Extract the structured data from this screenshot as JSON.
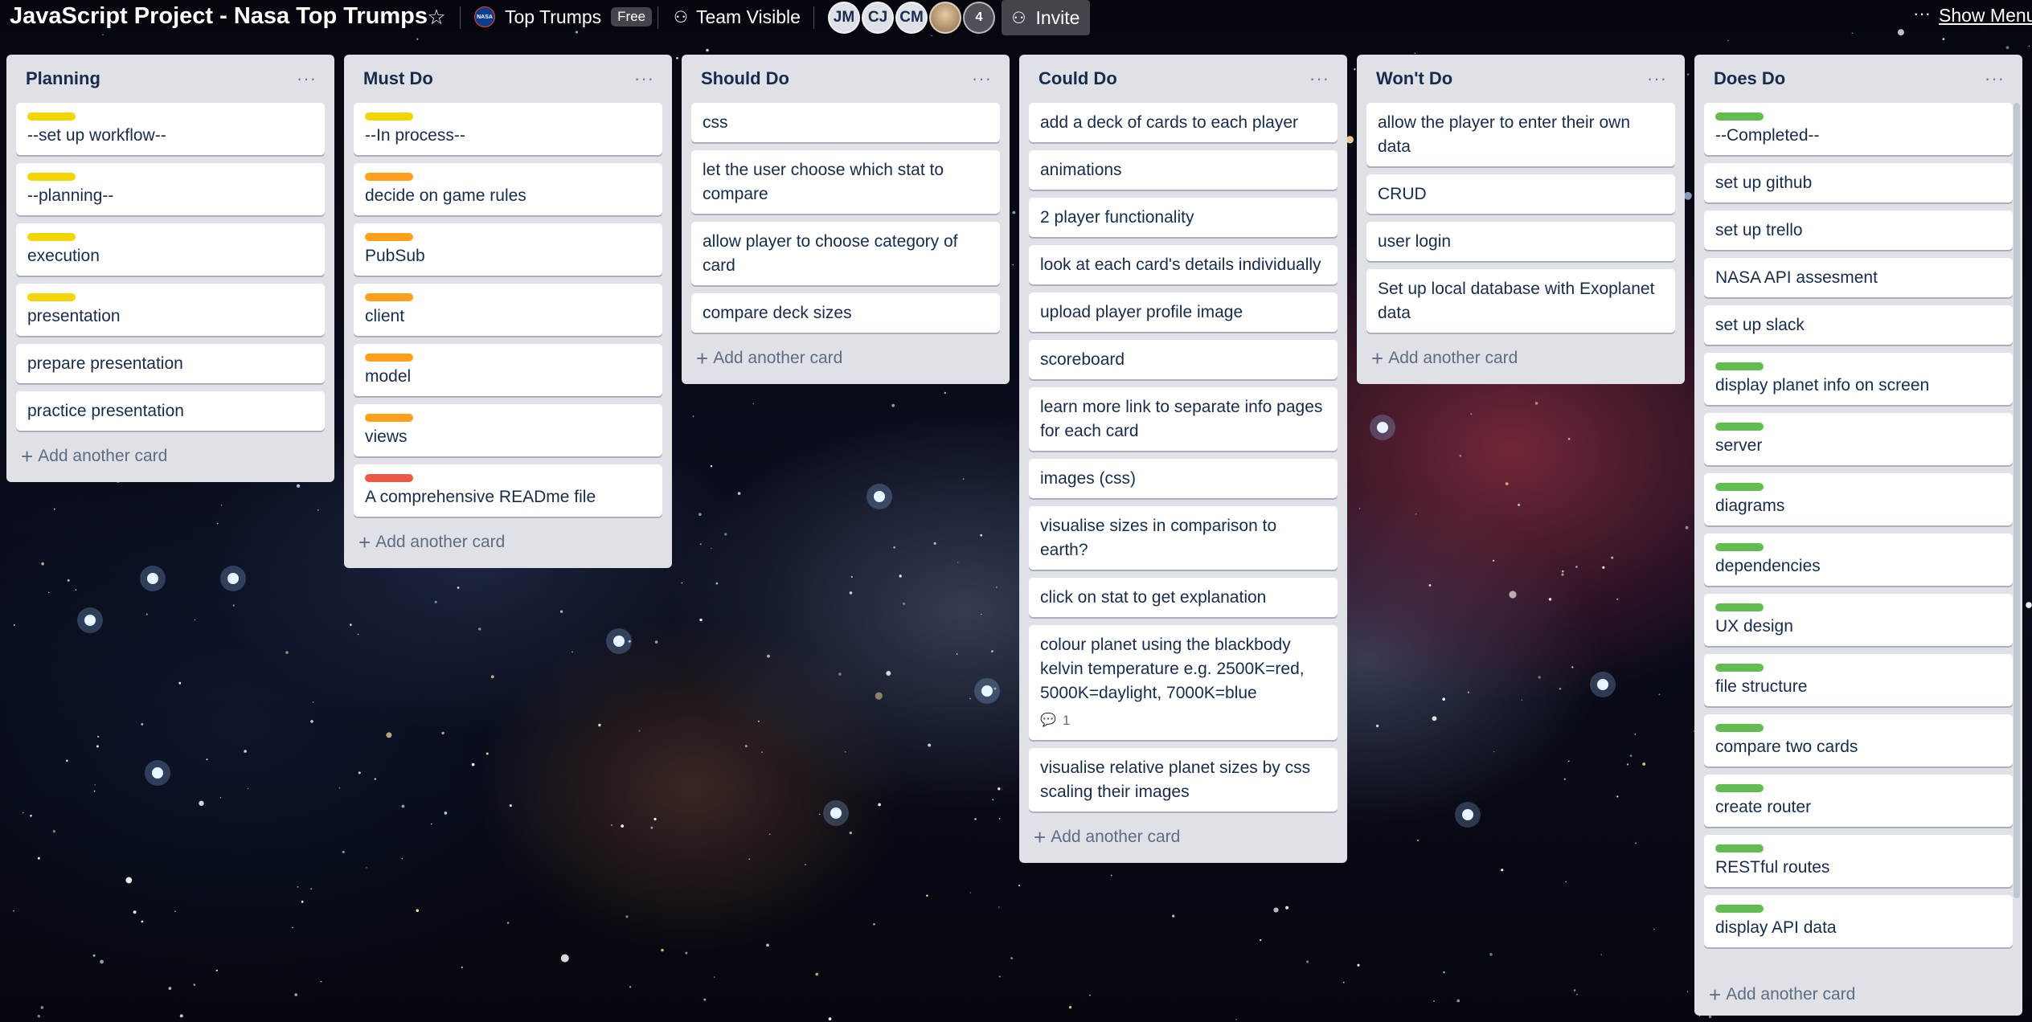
{
  "header": {
    "board_title": "JavaScript Project - Nasa Top Trumps",
    "star_icon": "star-icon",
    "team_name": "Top Trumps",
    "team_logo_text": "NASA",
    "team_badge": "Free",
    "visibility": "Team Visible",
    "members": [
      "JM",
      "CJ",
      "CM"
    ],
    "more_members": "4",
    "invite": "Invite",
    "show_menu": "Show Menu"
  },
  "label_colors": {
    "yellow": "#f2d600",
    "orange": "#ff9f1a",
    "red": "#eb5a46",
    "green": "#61bd4f"
  },
  "lists": [
    {
      "name": "Planning",
      "add_card": "Add another card",
      "cards": [
        {
          "label": "yellow",
          "text": "--set up workflow--"
        },
        {
          "label": "yellow",
          "text": "--planning--"
        },
        {
          "label": "yellow",
          "text": "execution"
        },
        {
          "label": "yellow",
          "text": "presentation"
        },
        {
          "label": null,
          "text": "prepare presentation"
        },
        {
          "label": null,
          "text": "practice presentation"
        }
      ]
    },
    {
      "name": "Must Do",
      "add_card": "Add another card",
      "cards": [
        {
          "label": "yellow",
          "text": "--In process--"
        },
        {
          "label": "orange",
          "text": "decide on game rules"
        },
        {
          "label": "orange",
          "text": "PubSub"
        },
        {
          "label": "orange",
          "text": "client"
        },
        {
          "label": "orange",
          "text": "model"
        },
        {
          "label": "orange",
          "text": "views"
        },
        {
          "label": "red",
          "text": "A comprehensive READme file"
        }
      ]
    },
    {
      "name": "Should Do",
      "add_card": "Add another card",
      "cards": [
        {
          "label": null,
          "text": "css"
        },
        {
          "label": null,
          "text": "let the user choose which stat to compare"
        },
        {
          "label": null,
          "text": "allow player to choose category of card"
        },
        {
          "label": null,
          "text": "compare deck sizes"
        }
      ]
    },
    {
      "name": "Could Do",
      "add_card": "Add another card",
      "cards": [
        {
          "label": null,
          "text": "add a deck of cards to each player"
        },
        {
          "label": null,
          "text": "animations"
        },
        {
          "label": null,
          "text": "2 player functionality"
        },
        {
          "label": null,
          "text": "look at each card's details individually"
        },
        {
          "label": null,
          "text": "upload player profile image"
        },
        {
          "label": null,
          "text": "scoreboard"
        },
        {
          "label": null,
          "text": "learn more link to separate info pages for each card"
        },
        {
          "label": null,
          "text": "images (css)"
        },
        {
          "label": null,
          "text": "visualise sizes in comparison to earth?"
        },
        {
          "label": null,
          "text": "click on stat to get explanation"
        },
        {
          "label": null,
          "text": "colour planet using the blackbody kelvin temperature e.g. 2500K=red, 5000K=daylight, 7000K=blue",
          "comments": "1"
        },
        {
          "label": null,
          "text": "visualise relative planet sizes by css scaling their images"
        }
      ]
    },
    {
      "name": "Won't Do",
      "add_card": "Add another card",
      "cards": [
        {
          "label": null,
          "text": "allow the player to enter their own data"
        },
        {
          "label": null,
          "text": "CRUD"
        },
        {
          "label": null,
          "text": "user login"
        },
        {
          "label": null,
          "text": "Set up local database with Exoplanet data"
        }
      ]
    },
    {
      "name": "Does Do",
      "add_card": "Add another card",
      "cards": [
        {
          "label": "green",
          "text": "--Completed--"
        },
        {
          "label": null,
          "text": "set up github"
        },
        {
          "label": null,
          "text": "set up trello"
        },
        {
          "label": null,
          "text": "NASA API assesment"
        },
        {
          "label": null,
          "text": "set up slack"
        },
        {
          "label": "green",
          "text": "display planet info on screen"
        },
        {
          "label": "green",
          "text": "server"
        },
        {
          "label": "green",
          "text": "diagrams"
        },
        {
          "label": "green",
          "text": "dependencies"
        },
        {
          "label": "green",
          "text": "UX design"
        },
        {
          "label": "green",
          "text": "file structure"
        },
        {
          "label": "green",
          "text": "compare two cards"
        },
        {
          "label": "green",
          "text": "create router"
        },
        {
          "label": "green",
          "text": "RESTful routes"
        },
        {
          "label": "green",
          "text": "display API data"
        }
      ]
    }
  ]
}
